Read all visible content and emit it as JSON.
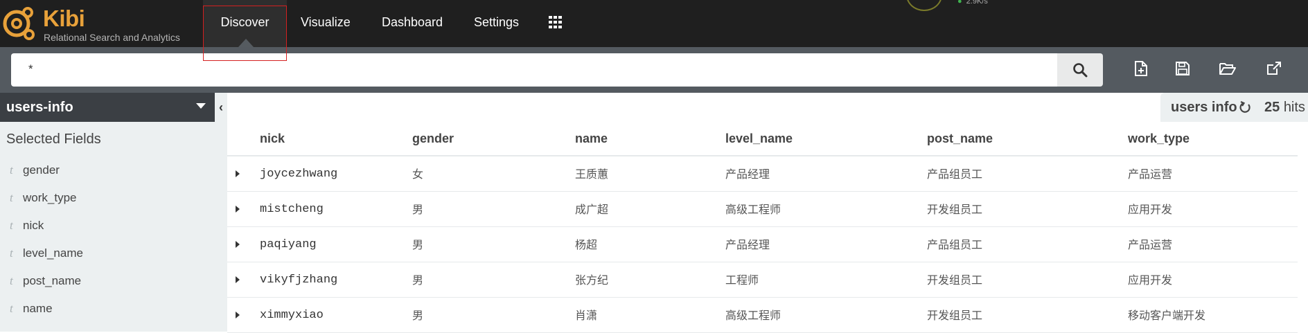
{
  "app": {
    "brand": "Kibi",
    "tagline": "Relational Search and Analytics",
    "speed": "2.9K/s"
  },
  "nav": {
    "items": [
      {
        "label": "Discover",
        "active": true
      },
      {
        "label": "Visualize",
        "active": false
      },
      {
        "label": "Dashboard",
        "active": false
      },
      {
        "label": "Settings",
        "active": false
      }
    ],
    "apps_icon": "grid-icon"
  },
  "search": {
    "query": "*",
    "button_icon": "search-icon"
  },
  "toolbar": {
    "icons": [
      "new-search-icon",
      "save-icon",
      "open-folder-icon",
      "share-icon"
    ]
  },
  "sidebar": {
    "index_pattern": "users-info",
    "selected_fields_title": "Selected Fields",
    "fields": [
      {
        "type": "t",
        "name": "gender"
      },
      {
        "type": "t",
        "name": "work_type"
      },
      {
        "type": "t",
        "name": "nick"
      },
      {
        "type": "t",
        "name": "level_name"
      },
      {
        "type": "t",
        "name": "post_name"
      },
      {
        "type": "t",
        "name": "name"
      }
    ]
  },
  "results": {
    "index_label": "users info",
    "hits_count": "25",
    "hits_label": "hits",
    "columns": [
      "nick",
      "gender",
      "name",
      "level_name",
      "post_name",
      "work_type"
    ],
    "rows": [
      [
        "joycezhwang",
        "女",
        "王质蕙",
        "产品经理",
        "产品组员工",
        "产品运营"
      ],
      [
        "mistcheng",
        "男",
        "成广超",
        "高级工程师",
        "开发组员工",
        "应用开发"
      ],
      [
        "paqiyang",
        "男",
        "杨超",
        "产品经理",
        "产品组员工",
        "产品运营"
      ],
      [
        "vikyfjzhang",
        "男",
        "张方纪",
        "工程师",
        "开发组员工",
        "应用开发"
      ],
      [
        "ximmyxiao",
        "男",
        "肖潇",
        "高级工程师",
        "开发组员工",
        "移动客户端开发"
      ]
    ]
  },
  "colors": {
    "topbar": "#1f1f1f",
    "searchbar": "#545a60",
    "sidebar": "#ecf0f1",
    "brand": "#e8a13a",
    "highlight": "#d42020"
  }
}
